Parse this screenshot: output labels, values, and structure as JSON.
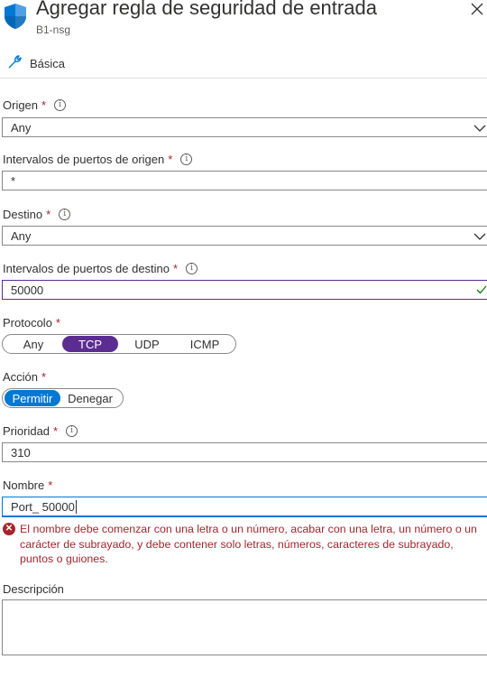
{
  "header": {
    "title": "Agregar regla de seguridad de entrada",
    "subtitle": "B1-nsg",
    "shield_icon": "shield-icon",
    "close_icon": "close-icon"
  },
  "tab": {
    "label": "Básica",
    "icon": "wrench-icon"
  },
  "form": {
    "origen": {
      "label": "Origen",
      "value": "Any"
    },
    "puertos_origen": {
      "label": "Intervalos de puertos de origen",
      "value": "*"
    },
    "destino": {
      "label": "Destino",
      "value": "Any"
    },
    "puertos_destino": {
      "label": "Intervalos de puertos de destino",
      "value": "50000"
    },
    "protocolo": {
      "label": "Protocolo",
      "options": [
        "Any",
        "TCP",
        "UDP",
        "ICMP"
      ],
      "selected": "TCP"
    },
    "accion": {
      "label": "Acción",
      "options": [
        "Permitir",
        "Denegar"
      ],
      "selected": "Permitir"
    },
    "prioridad": {
      "label": "Prioridad",
      "value": "310"
    },
    "nombre": {
      "label": "Nombre",
      "value": "Port_ 50000"
    },
    "error": "El nombre debe comenzar con una letra o un número, acabar con una letra, un número o un carácter de subrayado, y debe contener solo letras, números, caracteres de subrayado, puntos o guiones.",
    "descripcion": {
      "label": "Descripción",
      "value": ""
    }
  },
  "required_mark": "*",
  "info_glyph": "i",
  "colors": {
    "accent_purple": "#5c2d91",
    "accent_blue": "#0078d4",
    "error_red": "#a4262c",
    "valid_green": "#107c10"
  }
}
